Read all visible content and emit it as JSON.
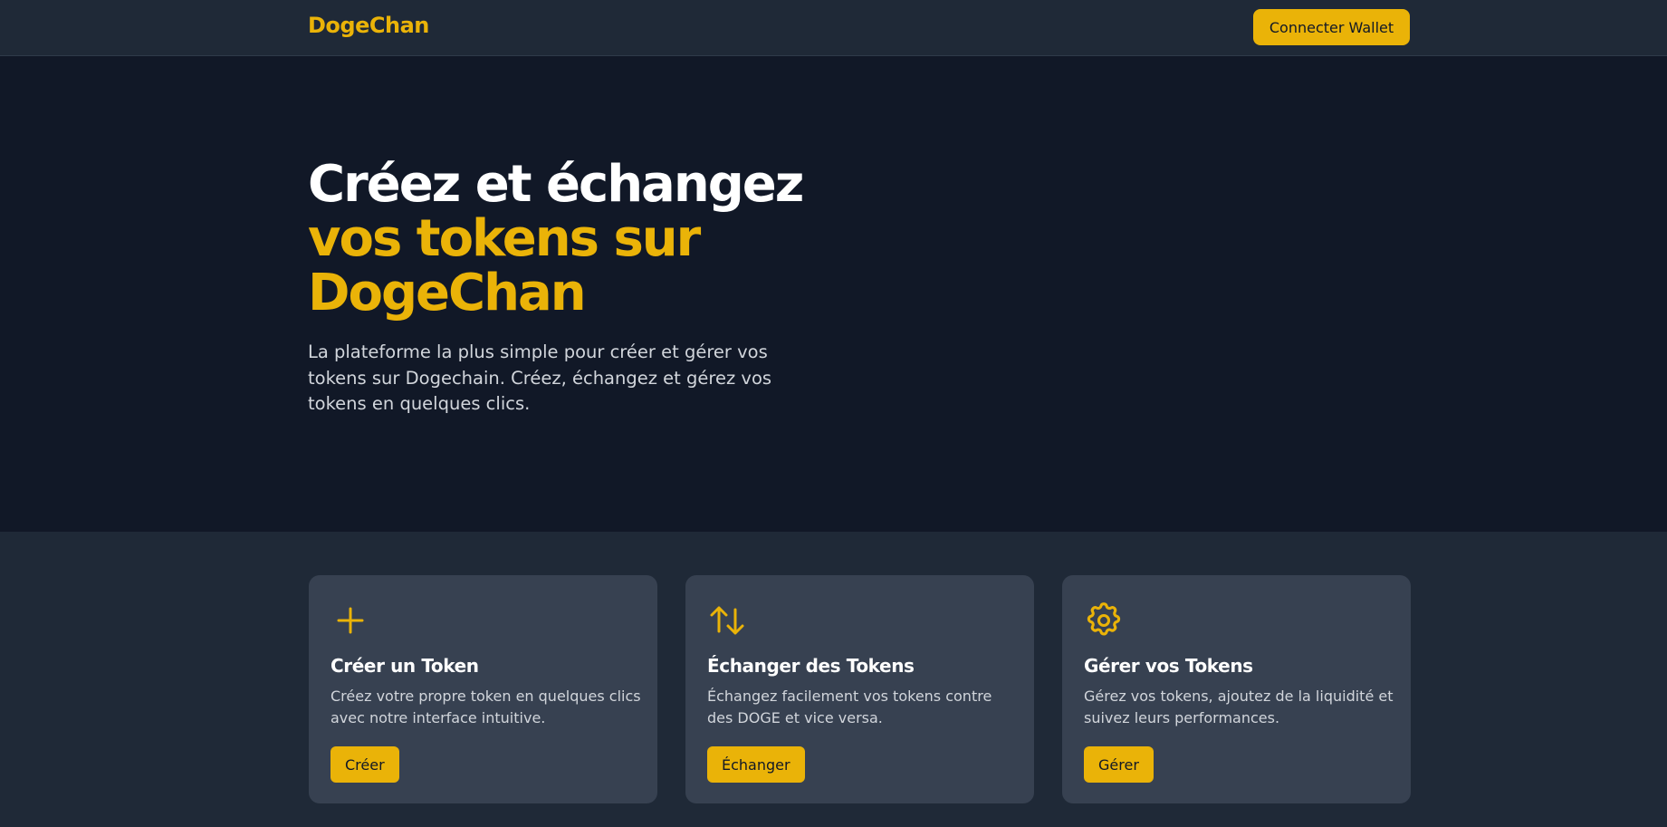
{
  "header": {
    "brand": "DogeChan",
    "connect_label": "Connecter Wallet"
  },
  "hero": {
    "title_line1": "Créez et échangez",
    "title_line2": "vos tokens sur DogeChan",
    "subtitle": "La plateforme la plus simple pour créer et gérer vos tokens sur Dogechain. Créez, échangez et gérez vos tokens en quelques clics."
  },
  "features": [
    {
      "icon": "plus-icon",
      "title": "Créer un Token",
      "description": "Créez votre propre token en quelques clics avec notre interface intuitive.",
      "button": "Créer"
    },
    {
      "icon": "swap-arrows-icon",
      "title": "Échanger des Tokens",
      "description": "Échangez facilement vos tokens contre des DOGE et vice versa.",
      "button": "Échanger"
    },
    {
      "icon": "gear-icon",
      "title": "Gérer vos Tokens",
      "description": "Gérez vos tokens, ajoutez de la liquidité et suivez leurs performances.",
      "button": "Gérer"
    }
  ],
  "colors": {
    "accent": "#eab308",
    "hero_bg": "#111827",
    "nav_bg": "#1f2937",
    "card_bg": "#374151"
  }
}
